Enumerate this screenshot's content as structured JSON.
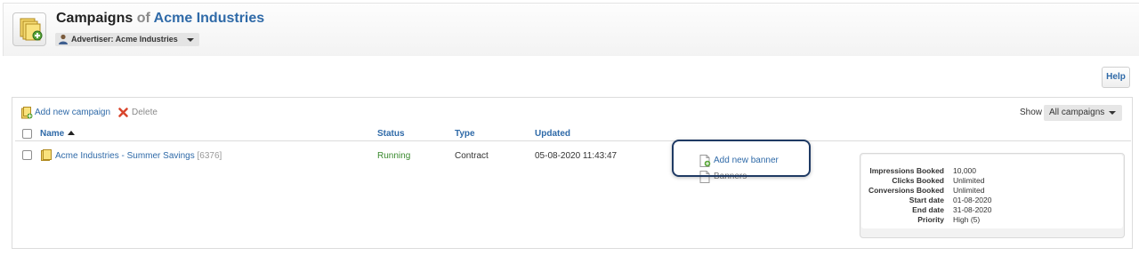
{
  "header": {
    "title_prefix": "Campaigns",
    "title_of": "of",
    "title_entity": "Acme Industries",
    "advertiser_label": "Advertiser: Acme Industries"
  },
  "help_label": "Help",
  "toolbar": {
    "add_campaign_label": "Add new campaign",
    "delete_label": "Delete",
    "show_label": "Show",
    "show_selected": "All campaigns"
  },
  "table": {
    "columns": {
      "name": "Name",
      "status": "Status",
      "type": "Type",
      "updated": "Updated"
    },
    "rows": [
      {
        "name": "Acme Industries - Summer Savings",
        "id": "[6376]",
        "status": "Running",
        "type": "Contract",
        "updated": "05-08-2020 11:43:47",
        "add_banner_label": "Add new banner",
        "banners_label": "Banners",
        "info": [
          {
            "label": "Impressions Booked",
            "value": "10,000"
          },
          {
            "label": "Clicks Booked",
            "value": "Unlimited"
          },
          {
            "label": "Conversions Booked",
            "value": "Unlimited"
          },
          {
            "label": "Start date",
            "value": "01-08-2020"
          },
          {
            "label": "End date",
            "value": "31-08-2020"
          },
          {
            "label": "Priority",
            "value": "High (5)"
          }
        ]
      }
    ]
  },
  "colors": {
    "link": "#2f6aa8",
    "status_running": "#3a8a2e",
    "highlight_border": "#1f3a64"
  },
  "icons": {
    "page": "campaigns-folder-icon",
    "advertiser": "user-icon",
    "add_campaign": "add-folder-icon",
    "delete": "delete-x-icon",
    "campaign": "folder-icon",
    "add_banner": "add-banner-icon",
    "banners": "banner-icon"
  }
}
